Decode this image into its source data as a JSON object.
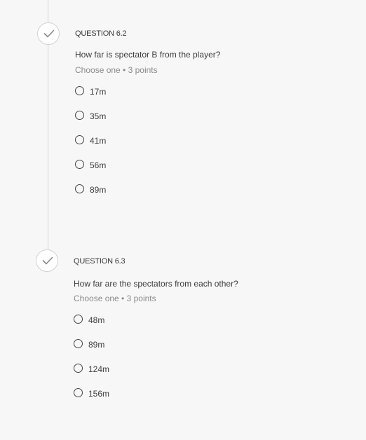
{
  "questions": [
    {
      "title": "QUESTION 6.2",
      "prompt": "How far is spectator B from the player?",
      "meta": "Choose one • 3 points",
      "options": [
        "17m",
        "35m",
        "41m",
        "56m",
        "89m"
      ]
    },
    {
      "title": "QUESTION 6.3",
      "prompt": "How far are the spectators from each other?",
      "meta": "Choose one • 3 points",
      "options": [
        "48m",
        "89m",
        "124m",
        "156m"
      ]
    }
  ],
  "icons": {
    "status": "check-icon"
  },
  "colors": {
    "background": "#f7f7f7",
    "timeline": "#d6d6d6",
    "check": "#8a8a8a"
  }
}
